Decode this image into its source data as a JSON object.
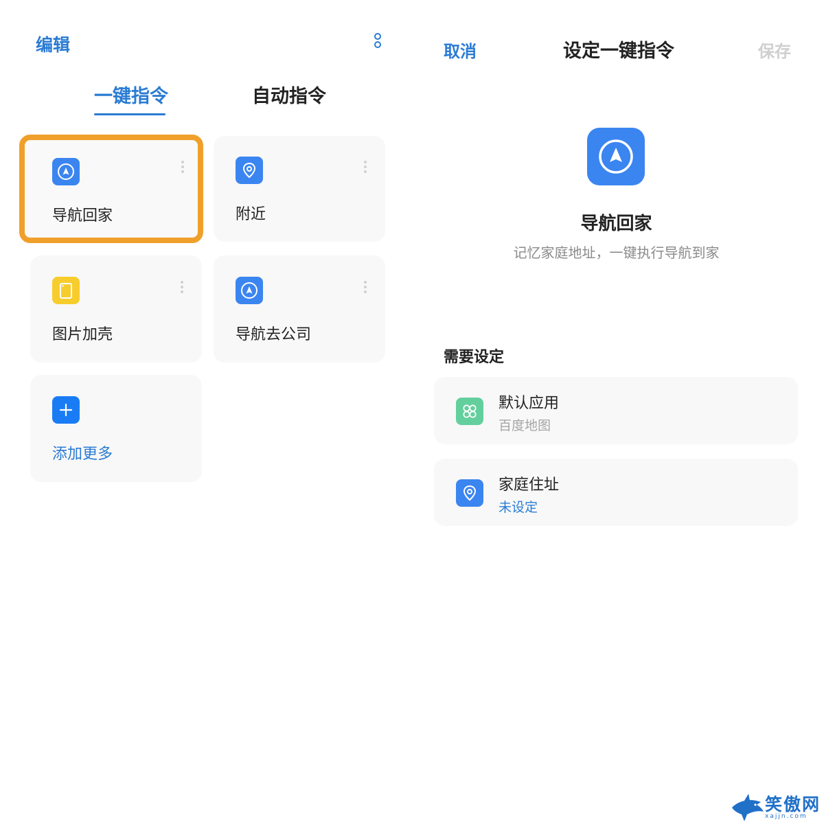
{
  "left_panel": {
    "edit_label": "编辑",
    "tabs": [
      {
        "label": "一键指令",
        "active": true
      },
      {
        "label": "自动指令",
        "active": false
      }
    ],
    "cards": [
      {
        "label": "导航回家",
        "icon": "navigation-icon",
        "color": "#3b85f0",
        "highlighted": true
      },
      {
        "label": "附近",
        "icon": "location-pin-icon",
        "color": "#3b85f0"
      },
      {
        "label": "图片加壳",
        "icon": "phone-frame-icon",
        "color": "#f7cd2d"
      },
      {
        "label": "导航去公司",
        "icon": "navigation-icon",
        "color": "#3b85f0"
      },
      {
        "label": "添加更多",
        "icon": "plus-icon",
        "color": "#1a7cf5"
      }
    ]
  },
  "right_panel": {
    "cancel_label": "取消",
    "title": "设定一键指令",
    "save_label": "保存",
    "command": {
      "name": "导航回家",
      "description": "记忆家庭地址，一键执行导航到家",
      "icon": "navigation-icon"
    },
    "section_label": "需要设定",
    "settings": [
      {
        "title": "默认应用",
        "value": "百度地图",
        "icon": "apps-icon",
        "color": "#63cf9d"
      },
      {
        "title": "家庭住址",
        "value": "未设定",
        "icon": "location-pin-icon",
        "color": "#3b85f0"
      }
    ]
  },
  "watermark": {
    "text": "笑傲网",
    "url": "xajjn.com",
    "icon": "shark-logo-icon"
  },
  "colors": {
    "accent": "#2a7bd3",
    "highlight_border": "#f0a02a",
    "card_bg": "#f8f8f8"
  }
}
